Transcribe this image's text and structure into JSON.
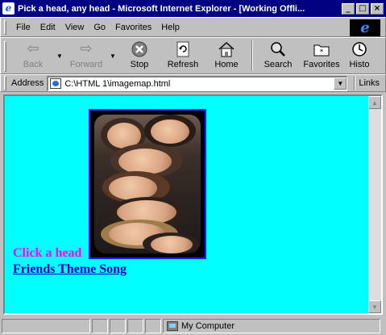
{
  "window": {
    "title": "Pick a head, any head - Microsoft Internet Explorer - [Working Offli...",
    "app_icon": "e",
    "buttons": [
      "_",
      "□",
      "×"
    ]
  },
  "menu": {
    "items": [
      {
        "label": "File",
        "accel": "F"
      },
      {
        "label": "Edit",
        "accel": "E"
      },
      {
        "label": "View",
        "accel": "V"
      },
      {
        "label": "Go",
        "accel": "G"
      },
      {
        "label": "Favorites",
        "accel": "a"
      },
      {
        "label": "Help",
        "accel": "H"
      }
    ],
    "logo": "e"
  },
  "toolbar": {
    "back": "Back",
    "forward": "Forward",
    "stop": "Stop",
    "refresh": "Refresh",
    "home": "Home",
    "search": "Search",
    "favorites": "Favorites",
    "history": "Histo"
  },
  "address": {
    "label": "Address",
    "value": "C:\\HTML 1\\imagemap.html",
    "links_label": "Links"
  },
  "content": {
    "image_alt": "Friends cast photo",
    "click_label": "Click a head",
    "song_link": "Friends Theme Song",
    "background": "#00ffff"
  },
  "status": {
    "zone": "My Computer"
  }
}
